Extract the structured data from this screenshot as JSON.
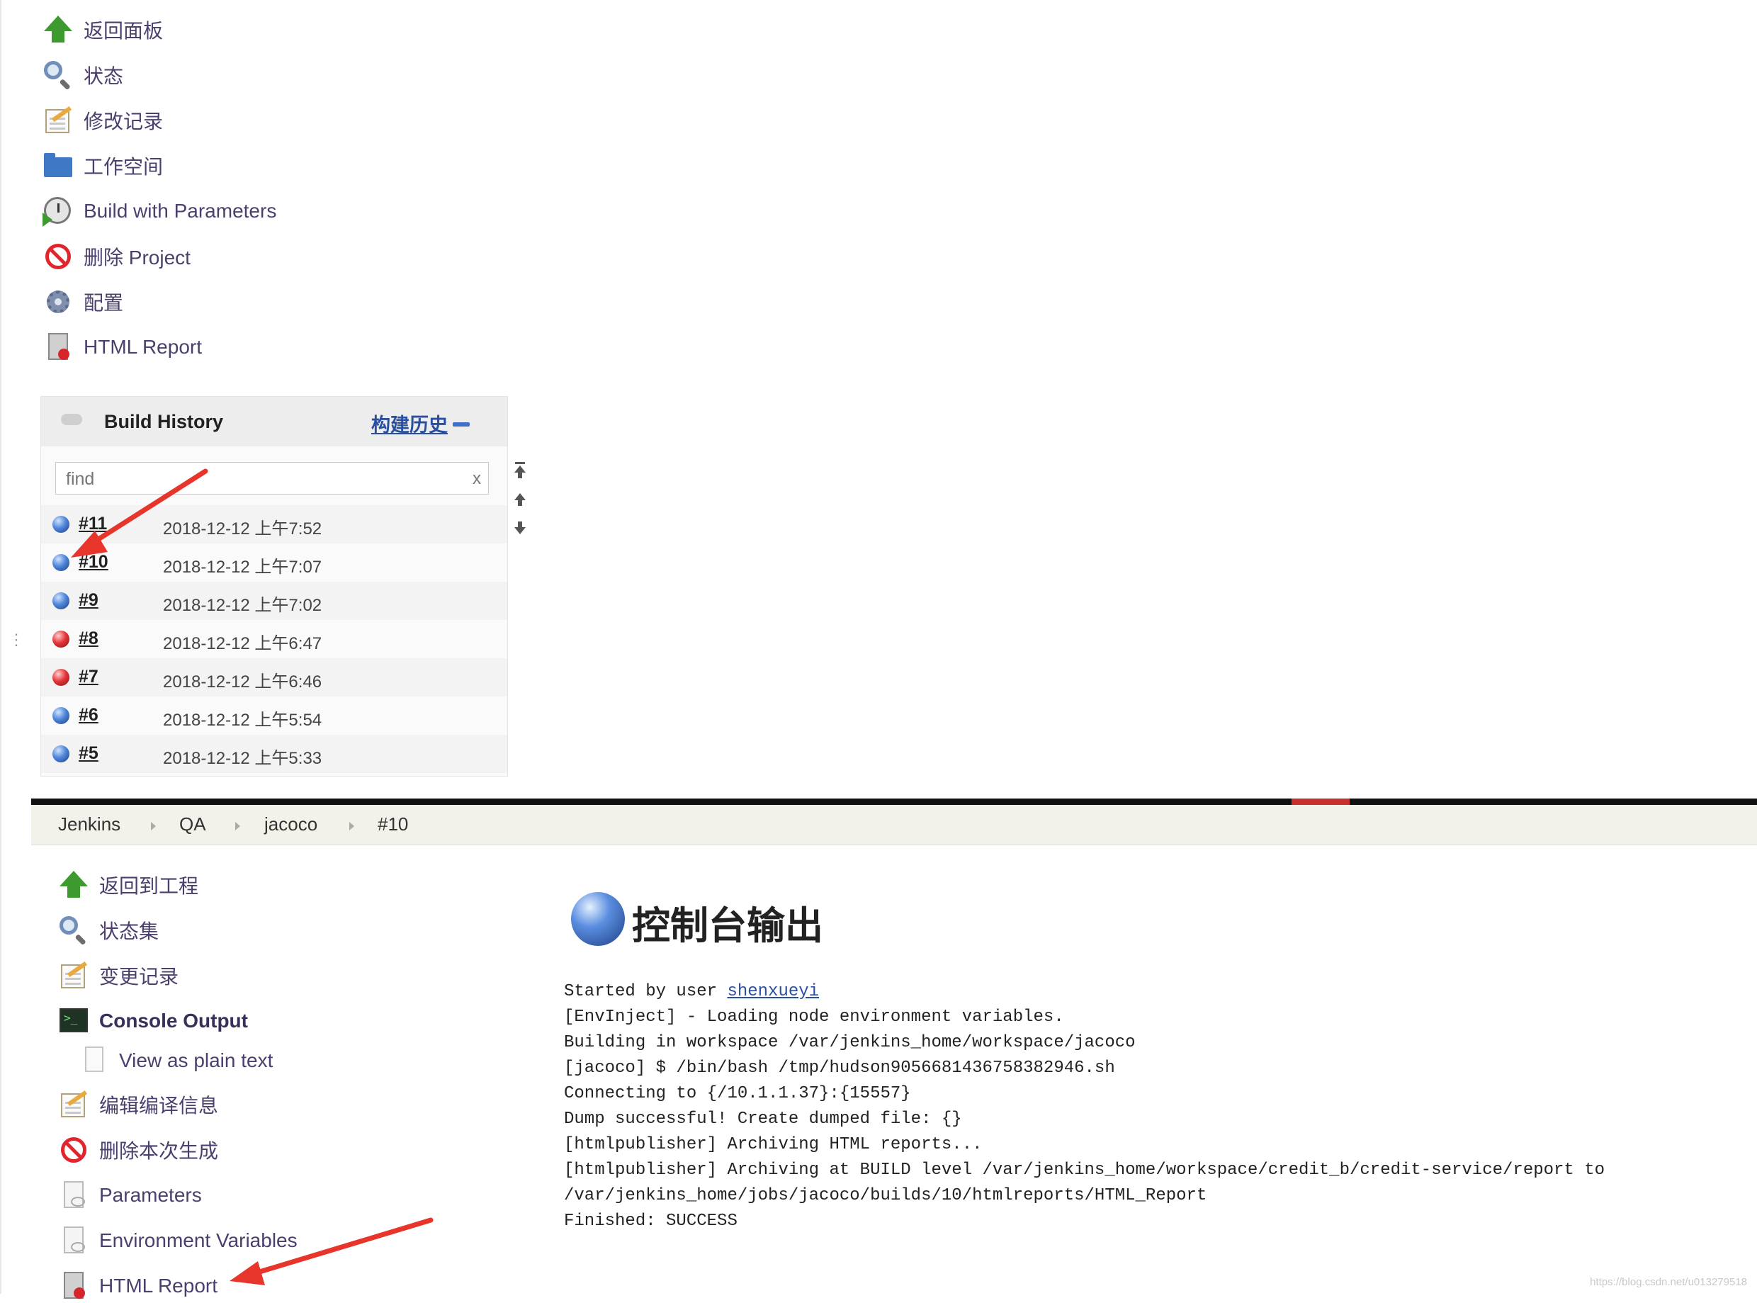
{
  "top_sidebar": {
    "items": [
      {
        "label": "返回面板",
        "icon": "up-arrow-icon"
      },
      {
        "label": "状态",
        "icon": "magnifier-icon"
      },
      {
        "label": "修改记录",
        "icon": "notepad-icon"
      },
      {
        "label": "工作空间",
        "icon": "folder-icon"
      },
      {
        "label": "Build with Parameters",
        "icon": "clock-icon"
      },
      {
        "label": "删除 Project",
        "icon": "no-entry-icon"
      },
      {
        "label": "配置",
        "icon": "gear-icon"
      },
      {
        "label": "HTML Report",
        "icon": "report-icon"
      }
    ]
  },
  "build_history": {
    "title": "Build History",
    "trend_link": "构建历史",
    "search_placeholder": "find",
    "clear_label": "x",
    "builds": [
      {
        "number": "#11",
        "date": "2018-12-12 上午7:52",
        "status": "blue"
      },
      {
        "number": "#10",
        "date": "2018-12-12 上午7:07",
        "status": "blue"
      },
      {
        "number": "#9",
        "date": "2018-12-12 上午7:02",
        "status": "blue"
      },
      {
        "number": "#8",
        "date": "2018-12-12 上午6:47",
        "status": "red"
      },
      {
        "number": "#7",
        "date": "2018-12-12 上午6:46",
        "status": "red"
      },
      {
        "number": "#6",
        "date": "2018-12-12 上午5:54",
        "status": "blue"
      },
      {
        "number": "#5",
        "date": "2018-12-12 上午5:33",
        "status": "blue"
      }
    ]
  },
  "breadcrumbs": [
    "Jenkins",
    "QA",
    "jacoco",
    "#10"
  ],
  "lower_sidebar": {
    "items": [
      {
        "label": "返回到工程",
        "icon": "up-arrow-icon"
      },
      {
        "label": "状态集",
        "icon": "magnifier-icon"
      },
      {
        "label": "变更记录",
        "icon": "notepad-icon"
      },
      {
        "label": "Console Output",
        "icon": "terminal-icon"
      },
      {
        "label": "View as plain text",
        "icon": "plain-text-icon"
      },
      {
        "label": "编辑编译信息",
        "icon": "notepad-icon"
      },
      {
        "label": "删除本次生成",
        "icon": "no-entry-icon"
      },
      {
        "label": "Parameters",
        "icon": "document-icon"
      },
      {
        "label": "Environment Variables",
        "icon": "document-icon"
      },
      {
        "label": "HTML Report",
        "icon": "report-icon"
      }
    ]
  },
  "console": {
    "title": "控制台输出",
    "started_prefix": "Started by user ",
    "user": "shenxueyi",
    "lines": [
      "[EnvInject] - Loading node environment variables.",
      "Building in workspace /var/jenkins_home/workspace/jacoco",
      "[jacoco] $ /bin/bash /tmp/hudson9056681436758382946.sh",
      "Connecting to {/10.1.1.37}:{15557}",
      "Dump successful! Create dumped file: {}",
      "[htmlpublisher] Archiving HTML reports...",
      "[htmlpublisher] Archiving at BUILD level /var/jenkins_home/workspace/credit_b/credit-service/report to",
      "/var/jenkins_home/jobs/jacoco/builds/10/htmlreports/HTML_Report",
      "Finished: SUCCESS"
    ]
  },
  "watermark": "https://blog.csdn.net/u013279518",
  "colors": {
    "link": "#4c3f6e",
    "annotation_red": "#e8352b",
    "status_blue": "#4f86d9",
    "status_red": "#e4373c"
  }
}
